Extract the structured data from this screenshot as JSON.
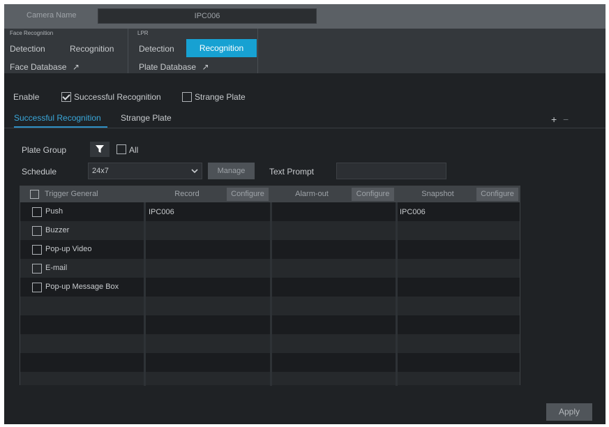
{
  "camera": {
    "label": "Camera Name",
    "value": "IPC006"
  },
  "face_recognition": {
    "title": "Face Recognition",
    "tabs": [
      "Detection",
      "Recognition"
    ],
    "database_link": "Face Database"
  },
  "lpr": {
    "title": "LPR",
    "tabs": [
      "Detection",
      "Recognition"
    ],
    "active_tab": "Recognition",
    "database_link": "Plate Database"
  },
  "enable": {
    "label": "Enable",
    "options": [
      {
        "label": "Successful Recognition",
        "checked": true
      },
      {
        "label": "Strange Plate",
        "checked": false
      }
    ]
  },
  "sub_tabs": [
    "Successful Recognition",
    "Strange Plate"
  ],
  "active_sub_tab": "Successful Recognition",
  "add_remove": {
    "add": "+",
    "remove": "−"
  },
  "plate_group": {
    "label": "Plate Group",
    "all_label": "All"
  },
  "schedule": {
    "label": "Schedule",
    "value": "24x7",
    "manage_button": "Manage",
    "text_prompt_label": "Text Prompt",
    "text_prompt_value": ""
  },
  "table": {
    "trigger_header": "Trigger General",
    "record_header": "Record",
    "alarm_header": "Alarm-out",
    "snapshot_header": "Snapshot",
    "configure_label": "Configure",
    "triggers": [
      "Push",
      "Buzzer",
      "Pop-up Video",
      "E-mail",
      "Pop-up Message Box"
    ],
    "record_value": "IPC006",
    "snapshot_value": "IPC006"
  },
  "apply_button": "Apply"
}
